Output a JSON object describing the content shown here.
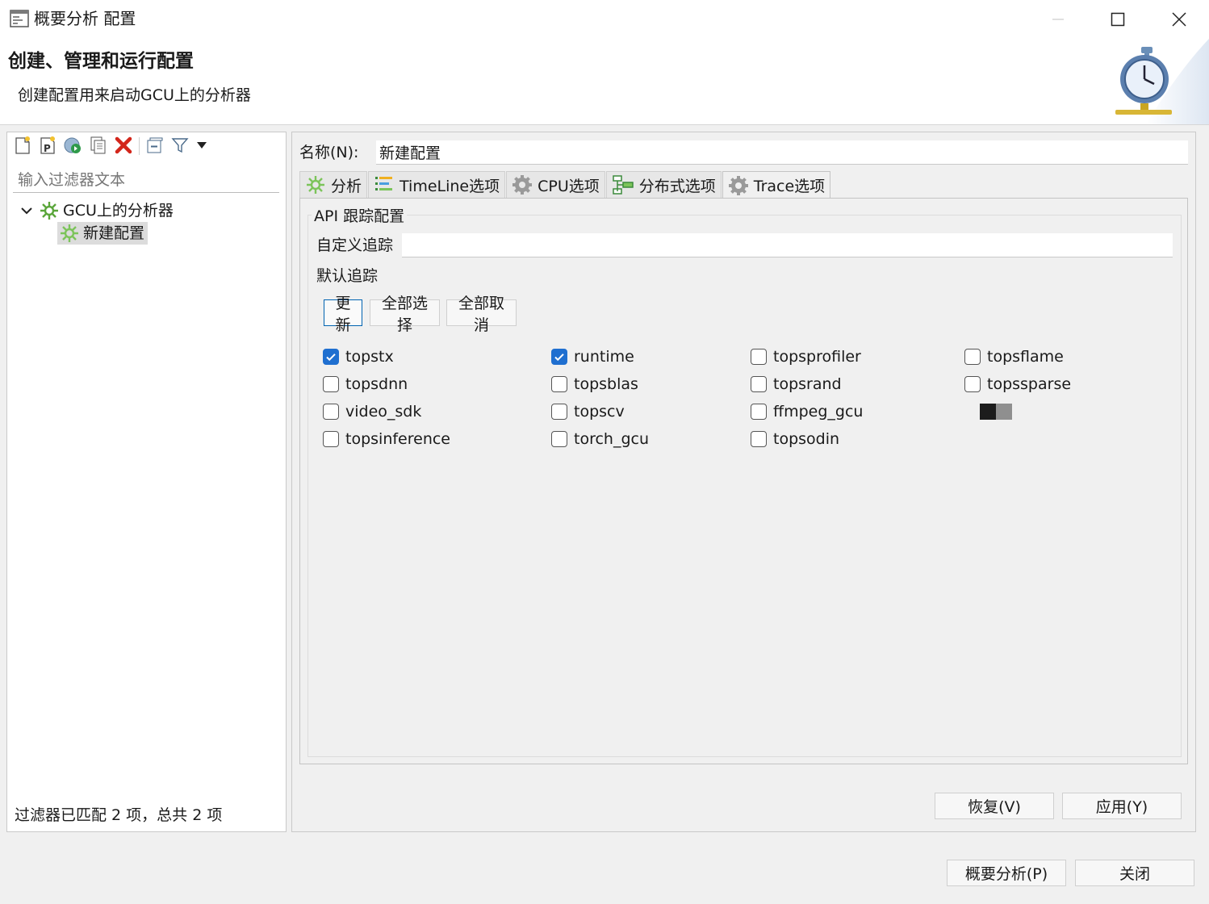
{
  "window": {
    "title": "概要分析 配置"
  },
  "banner": {
    "title": "创建、管理和运行配置",
    "description": "创建配置用来启动GCU上的分析器"
  },
  "left": {
    "filter_placeholder": "输入过滤器文本",
    "tree": {
      "root": "GCU上的分析器",
      "child": "新建配置"
    },
    "status": "过滤器已匹配 2 项，总共 2 项"
  },
  "config": {
    "name_label": "名称(N):",
    "name_value": "新建配置"
  },
  "tabs": [
    {
      "label": "分析",
      "icon": "analyzer-icon"
    },
    {
      "label": "TimeLine选项",
      "icon": "timeline-icon"
    },
    {
      "label": "CPU选项",
      "icon": "gear-icon"
    },
    {
      "label": "分布式选项",
      "icon": "distributed-icon"
    },
    {
      "label": "Trace选项",
      "icon": "gear-icon"
    }
  ],
  "trace": {
    "group_title": "API 跟踪配置",
    "custom_label": "自定义追踪",
    "custom_value": "",
    "default_label": "默认追踪",
    "buttons": {
      "update": "更新",
      "select_all": "全部选择",
      "deselect_all": "全部取消"
    },
    "checkboxes": [
      {
        "label": "topstx",
        "checked": true
      },
      {
        "label": "runtime",
        "checked": true
      },
      {
        "label": "topsprofiler",
        "checked": false
      },
      {
        "label": "topsflame",
        "checked": false
      },
      {
        "label": "topsdnn",
        "checked": false
      },
      {
        "label": "topsblas",
        "checked": false
      },
      {
        "label": "topsrand",
        "checked": false
      },
      {
        "label": "topssparse",
        "checked": false
      },
      {
        "label": "video_sdk",
        "checked": false
      },
      {
        "label": "topscv",
        "checked": false
      },
      {
        "label": "ffmpeg_gcu",
        "checked": false
      },
      {
        "label": "topsinference",
        "checked": false
      },
      {
        "label": "torch_gcu",
        "checked": false
      },
      {
        "label": "topsodin",
        "checked": false
      }
    ]
  },
  "footer": {
    "revert": "恢复(V)",
    "apply": "应用(Y)",
    "profile": "概要分析(P)",
    "close": "关闭"
  },
  "colors": {
    "accent": "#1f6fd0",
    "focus": "#0063b1"
  }
}
